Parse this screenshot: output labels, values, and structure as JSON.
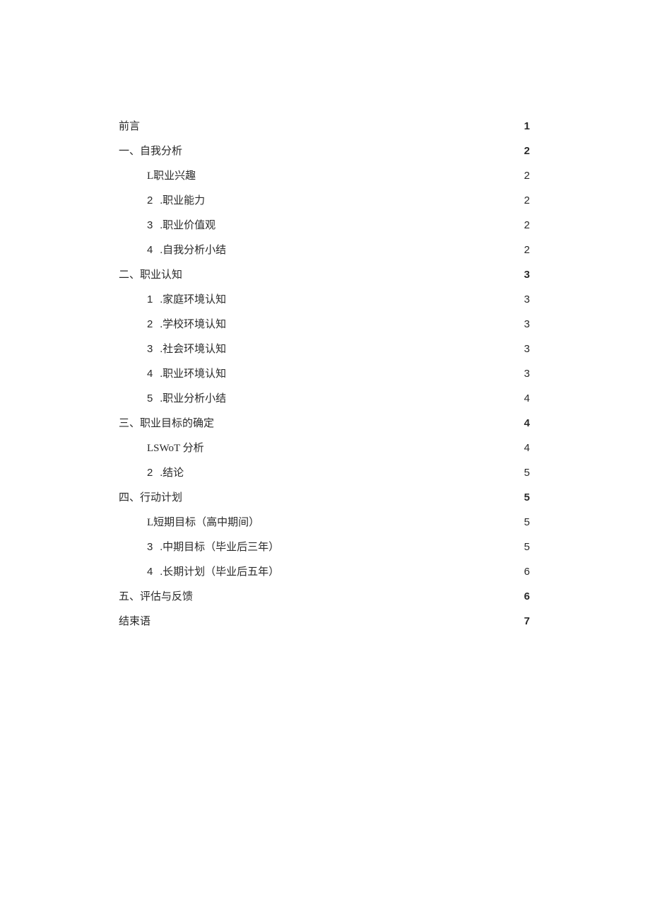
{
  "toc": [
    {
      "level": 0,
      "prefix": "",
      "num": "",
      "title": "前言",
      "space": " ",
      "page": "1",
      "boldTitle": false,
      "boldPage": true
    },
    {
      "level": 0,
      "prefix": "一、",
      "num": "",
      "title": "自我分析",
      "space": " ",
      "page": "2",
      "boldTitle": false,
      "boldPage": true
    },
    {
      "level": 1,
      "prefix": "",
      "num": "",
      "title": "L职业兴趣",
      "space": " ",
      "page": "2",
      "boldTitle": false,
      "boldPage": false
    },
    {
      "level": 1,
      "prefix": "",
      "num": "2",
      "title": ".职业能力",
      "space": " ",
      "page": "2",
      "boldTitle": false,
      "boldPage": false
    },
    {
      "level": 1,
      "prefix": "",
      "num": "3",
      "title": ".职业价值观",
      "space": " ",
      "page": "2",
      "boldTitle": false,
      "boldPage": false
    },
    {
      "level": 1,
      "prefix": "",
      "num": "4",
      "title": ".自我分析小结",
      "space": "",
      "page": "2",
      "boldTitle": false,
      "boldPage": false
    },
    {
      "level": 0,
      "prefix": "二、",
      "num": "",
      "title": "职业认知",
      "space": " ",
      "page": "3",
      "boldTitle": false,
      "boldPage": true
    },
    {
      "level": 1,
      "prefix": "",
      "num": "1",
      "title": ".家庭环境认知",
      "space": "",
      "page": "3",
      "boldTitle": false,
      "boldPage": false
    },
    {
      "level": 1,
      "prefix": "",
      "num": "2",
      "title": ".学校环境认知",
      "space": "",
      "page": "3",
      "boldTitle": false,
      "boldPage": false
    },
    {
      "level": 1,
      "prefix": "",
      "num": "3",
      "title": ".社会环境认知",
      "space": "",
      "page": "3",
      "boldTitle": false,
      "boldPage": false
    },
    {
      "level": 1,
      "prefix": "",
      "num": "4",
      "title": ".职业环境认知",
      "space": "",
      "page": "3",
      "boldTitle": false,
      "boldPage": false
    },
    {
      "level": 1,
      "prefix": "",
      "num": "5",
      "title": ".职业分析小结",
      "space": "",
      "page": "4",
      "boldTitle": false,
      "boldPage": false
    },
    {
      "level": 0,
      "prefix": "三、",
      "num": "",
      "title": "职业目标的确定",
      "space": " ",
      "page": "4",
      "boldTitle": false,
      "boldPage": true
    },
    {
      "level": 1,
      "prefix": "",
      "num": "",
      "title": "LSWoT 分析",
      "space": " ",
      "page": "4",
      "boldTitle": false,
      "boldPage": false
    },
    {
      "level": 1,
      "prefix": "",
      "num": "2",
      "title": ".结论",
      "space": " ",
      "page": "5",
      "boldTitle": false,
      "boldPage": false
    },
    {
      "level": 0,
      "prefix": "四、",
      "num": "",
      "title": "行动计划",
      "space": " ",
      "page": "5",
      "boldTitle": false,
      "boldPage": true
    },
    {
      "level": 1,
      "prefix": "",
      "num": "",
      "title": "L短期目标（高中期间）",
      "space": " ",
      "page": "5",
      "boldTitle": false,
      "boldPage": false
    },
    {
      "level": 1,
      "prefix": "",
      "num": "3",
      "title": ".中期目标（毕业后三年）",
      "space": " ",
      "page": "5",
      "boldTitle": false,
      "boldPage": false
    },
    {
      "level": 1,
      "prefix": "",
      "num": "4",
      "title": ".长期计划（毕业后五年）",
      "space": " ",
      "page": "6",
      "boldTitle": false,
      "boldPage": false
    },
    {
      "level": 0,
      "prefix": "五、",
      "num": "",
      "title": "评估与反馈",
      "space": " ",
      "page": "6",
      "boldTitle": false,
      "boldPage": true
    },
    {
      "level": 0,
      "prefix": "",
      "num": "",
      "title": "结束语",
      "space": " ",
      "page": "7",
      "boldTitle": false,
      "boldPage": true
    }
  ]
}
